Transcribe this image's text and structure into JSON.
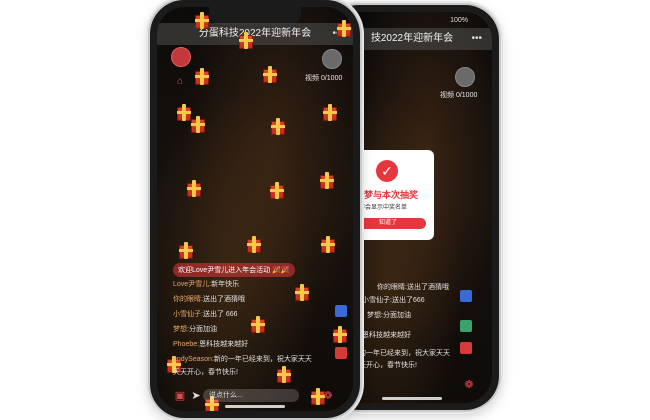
{
  "front": {
    "title": "分蛋科技2022年迎新年会",
    "views_label": "视频",
    "views_count": "0/1000",
    "join_notice": "欢迎Love尹雪儿进入年会活动 🎉🎉",
    "chat": [
      {
        "user": "Love尹雪儿:",
        "text": "新年快乐"
      },
      {
        "user": "你的眼睛:",
        "text": "送出了酒猜哦"
      },
      {
        "user": "小雪仙子:",
        "text": "送出了 666"
      },
      {
        "user": "梦想:",
        "text": "分面加油"
      },
      {
        "user": "Phoebe:",
        "text": "恩科技越来越好"
      },
      {
        "user": "endySeason:",
        "text": "新的一年已经来到，祝大家天天"
      },
      {
        "user": "",
        "text": "天天开心，春节快乐!"
      }
    ],
    "input_placeholder": "说点什么..."
  },
  "back": {
    "title": "技2022年迎新年会",
    "views_label": "视频",
    "views_count": "0/1000",
    "chat": [
      {
        "text": "你的眼睛:送出了酒猜哦"
      },
      {
        "text": "小雪仙子:送出了666"
      },
      {
        "text": "梦想:分面加油"
      },
      {
        "text": "恩科技越来越好"
      },
      {
        "text": "新的一年已经来到，祝大家天天"
      },
      {
        "text": "天天开心，春节快乐!"
      }
    ]
  },
  "modal": {
    "title": "助梦与本次抽奖",
    "subtitle": "大屏会显示中奖名单",
    "ok_label": "知道了"
  },
  "colors": {
    "accent": "#e5373d",
    "gift": "#d43a25",
    "ribbon": "#f3c94a"
  }
}
